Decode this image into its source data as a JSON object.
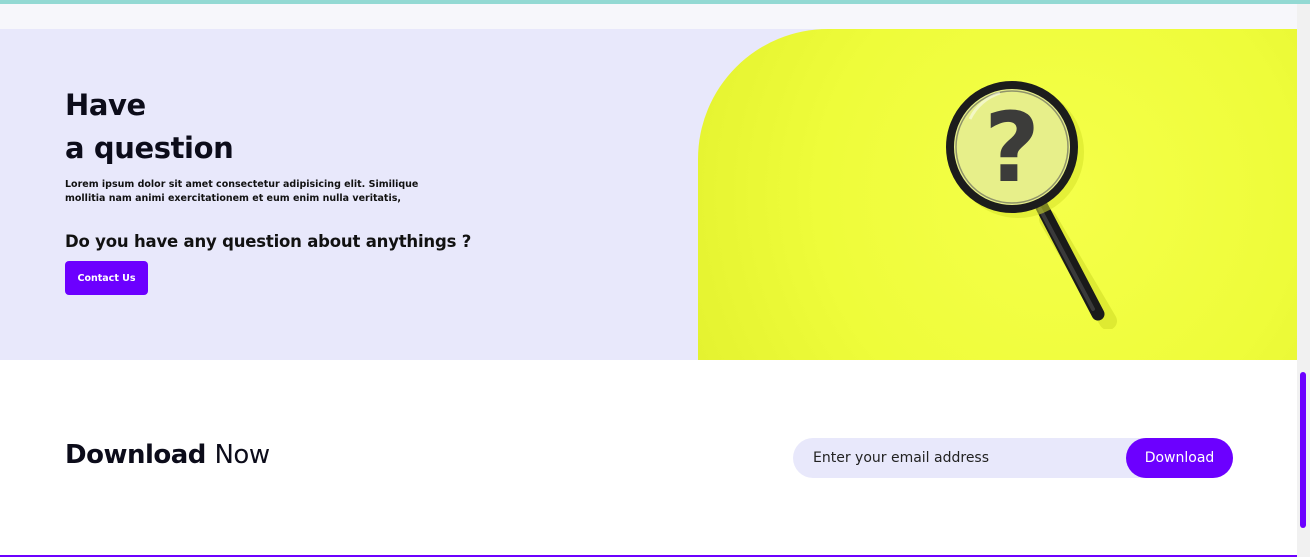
{
  "question_section": {
    "title_line1": "Have",
    "title_line2": "a question",
    "description": "Lorem ipsum dolor sit amet consectetur adipisicing elit. Similique mollitia nam animi exercitationem et eum enim nulla veritatis,",
    "subheading": "Do you have any question about anythings ?",
    "contact_button_label": "Contact Us",
    "image_icon": "magnifying-glass-question-mark",
    "panel_color": "#f2fd41"
  },
  "download_section": {
    "title_bold": "Download",
    "title_light": "Now",
    "email_placeholder": "Enter your email address",
    "download_button_label": "Download"
  },
  "colors": {
    "accent": "#6c00ff",
    "section_bg": "#e8e8fb",
    "top_border": "#93d9d3"
  }
}
